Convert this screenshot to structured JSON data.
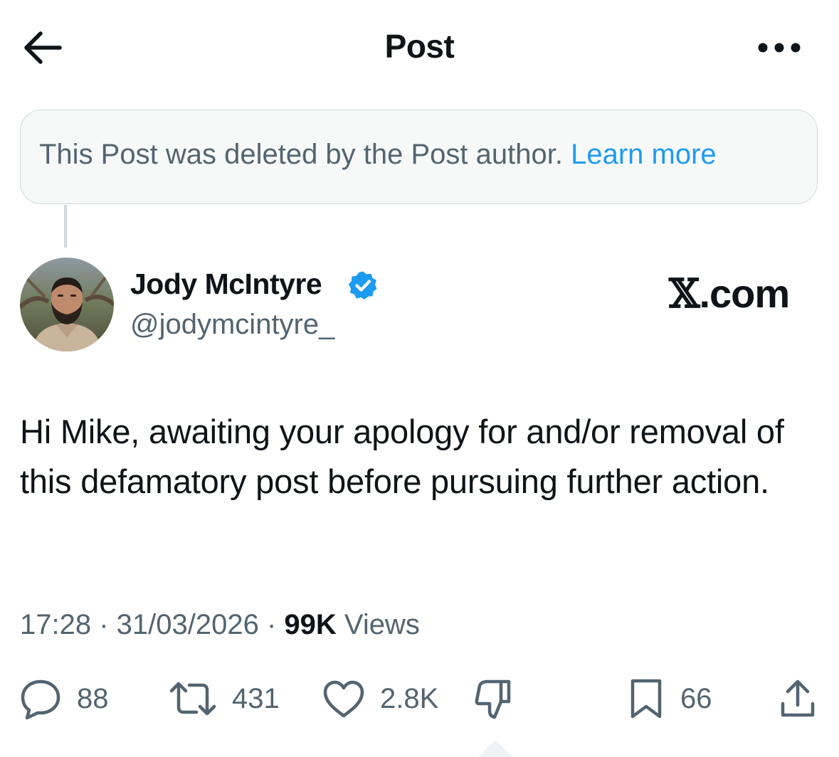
{
  "header": {
    "title": "Post",
    "back_icon": "arrow-left-icon",
    "more_icon": "more-horizontal-icon"
  },
  "deleted_notice": {
    "text": "This Post was deleted by the Post author.",
    "link": "Learn more"
  },
  "author": {
    "display_name": "Jody McIntyre",
    "handle": "@jodymcintyre_",
    "verified": true,
    "verified_color": "#1d9bf0"
  },
  "watermark": {
    "logo": "𝕏",
    "text": ".com"
  },
  "post": {
    "text": "Hi Mike, awaiting your apology for and/or removal of this defamatory post before pursuing further action.",
    "time": "17:28",
    "separator": " · ",
    "date": "31/03/2026",
    "views_count": "99K",
    "views_label": "Views"
  },
  "actions": {
    "replies": "88",
    "reposts": "431",
    "likes": "2.8K",
    "bookmarks": "66"
  },
  "colors": {
    "text_primary": "#0f1419",
    "text_secondary": "#536471",
    "accent": "#1d9bf0",
    "border": "#cfd9de"
  }
}
